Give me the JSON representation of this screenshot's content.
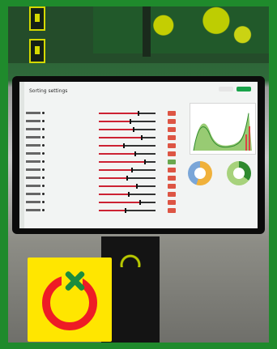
{
  "photo": {
    "description": "Photo of a monitor showing a Sorting settings dashboard with sliders and charts, with a yellow/red/green logo overlay.",
    "screen": {
      "title": "Sorting settings"
    },
    "logo": {
      "colors": {
        "background": "#ffe600",
        "ring": "#ee1c25",
        "mark": "#1b8c3e"
      }
    }
  }
}
